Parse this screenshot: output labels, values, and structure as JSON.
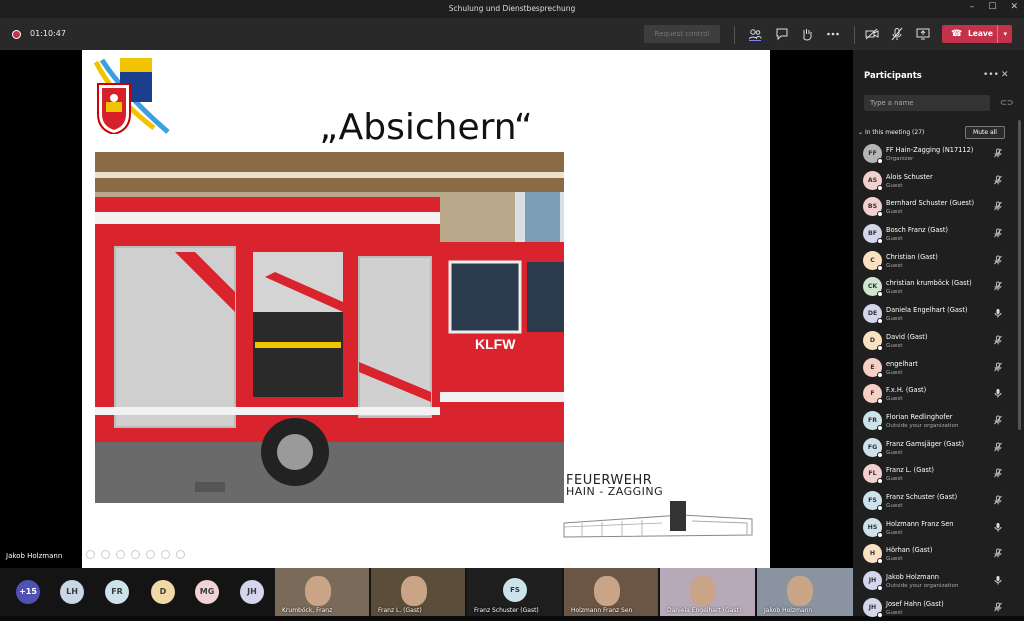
{
  "window": {
    "title": "Schulung und Dienstbesprechung",
    "minimize": "–",
    "maximize": "☐",
    "close": "✕"
  },
  "toolbar": {
    "timer": "01:10:47",
    "request_control": "Request control",
    "leave": "Leave"
  },
  "slide": {
    "title": "„Absichern“",
    "brand_line1": "FEUERWEHR",
    "brand_line2": "HAIN - ZAGGING",
    "vehicle_label": "KLFW"
  },
  "stage": {
    "speaker": "Jakob Holzmann"
  },
  "strip": {
    "avatars": [
      {
        "initials": "+15",
        "color": "#4f52b2",
        "fg": "#ffffff"
      },
      {
        "initials": "LH",
        "color": "#c8d6e5",
        "fg": "#3b3b3b"
      },
      {
        "initials": "FR",
        "color": "#cde3ec",
        "fg": "#3b3b3b"
      },
      {
        "initials": "D",
        "color": "#f1d9a6",
        "fg": "#3b3b3b"
      },
      {
        "initials": "MG",
        "color": "#f0d3d6",
        "fg": "#3b3b3b"
      },
      {
        "initials": "JH",
        "color": "#d5d6ee",
        "fg": "#3b3b3b"
      }
    ],
    "videos": [
      {
        "label": "Krumböck, Franz",
        "bg": "#7a6a5a"
      },
      {
        "label": "Franz L. (Gast)",
        "bg": "#5a4d3a"
      },
      {
        "label": "Franz Schuster (Gast)",
        "bg": "#1e1e1e",
        "initials": "FS"
      },
      {
        "label": "Holzmann Franz Sen",
        "bg": "#6b5646"
      },
      {
        "label": "Daniela Engelhart (Gast)",
        "bg": "#b8a9b8"
      },
      {
        "label": "Jakob Holzmann",
        "bg": "#8a93a0"
      }
    ]
  },
  "panel": {
    "title": "Participants",
    "search_placeholder": "Type a name",
    "section": "In this meeting (27)",
    "mute_all": "Mute all",
    "participants": [
      {
        "initials": "FF",
        "name": "FF Hain-Zagging (N17112)",
        "role": "Organizer",
        "color": "#b5b5b5",
        "mic": "muted"
      },
      {
        "initials": "AS",
        "name": "Alois Schuster",
        "role": "Guest",
        "color": "#f3d0d0",
        "mic": "muted"
      },
      {
        "initials": "BS",
        "name": "Bernhard Schuster (Guest)",
        "role": "Guest",
        "color": "#f3d0d0",
        "mic": "muted"
      },
      {
        "initials": "BF",
        "name": "Bosch Franz (Gast)",
        "role": "Guest",
        "color": "#d5d6ee",
        "mic": "muted"
      },
      {
        "initials": "C",
        "name": "Christian (Gast)",
        "role": "Guest",
        "color": "#f9e1c1",
        "mic": "muted"
      },
      {
        "initials": "CK",
        "name": "christian krumböck (Gast)",
        "role": "Guest",
        "color": "#cfe6d0",
        "mic": "muted"
      },
      {
        "initials": "DE",
        "name": "Daniela Engelhart (Gast)",
        "role": "Guest",
        "color": "#d5d6ee",
        "mic": "on"
      },
      {
        "initials": "D",
        "name": "David (Gast)",
        "role": "Guest",
        "color": "#f9e1c1",
        "mic": "muted"
      },
      {
        "initials": "E",
        "name": "engelhart",
        "role": "Guest",
        "color": "#f7cfc4",
        "mic": "muted"
      },
      {
        "initials": "F",
        "name": "F.x.H. (Gast)",
        "role": "Guest",
        "color": "#f7cfc4",
        "mic": "on"
      },
      {
        "initials": "FR",
        "name": "Florian Redlinghofer",
        "role": "Outside your organization",
        "color": "#cde3ec",
        "mic": "muted"
      },
      {
        "initials": "FG",
        "name": "Franz Gamsjäger (Gast)",
        "role": "Guest",
        "color": "#cde3ec",
        "mic": "muted"
      },
      {
        "initials": "FL",
        "name": "Franz L. (Gast)",
        "role": "Guest",
        "color": "#f3d0d0",
        "mic": "muted"
      },
      {
        "initials": "FS",
        "name": "Franz Schuster (Gast)",
        "role": "Guest",
        "color": "#cde3ec",
        "mic": "muted"
      },
      {
        "initials": "HS",
        "name": "Holzmann Franz Sen",
        "role": "Guest",
        "color": "#cde3ec",
        "mic": "on"
      },
      {
        "initials": "H",
        "name": "Hörhan (Gast)",
        "role": "Guest",
        "color": "#f9e1c1",
        "mic": "muted"
      },
      {
        "initials": "JH",
        "name": "Jakob Holzmann",
        "role": "Outside your organization",
        "color": "#d5d6ee",
        "mic": "on"
      },
      {
        "initials": "JH",
        "name": "Josef Hahn (Gast)",
        "role": "Guest",
        "color": "#d5d6ee",
        "mic": "muted"
      }
    ]
  }
}
